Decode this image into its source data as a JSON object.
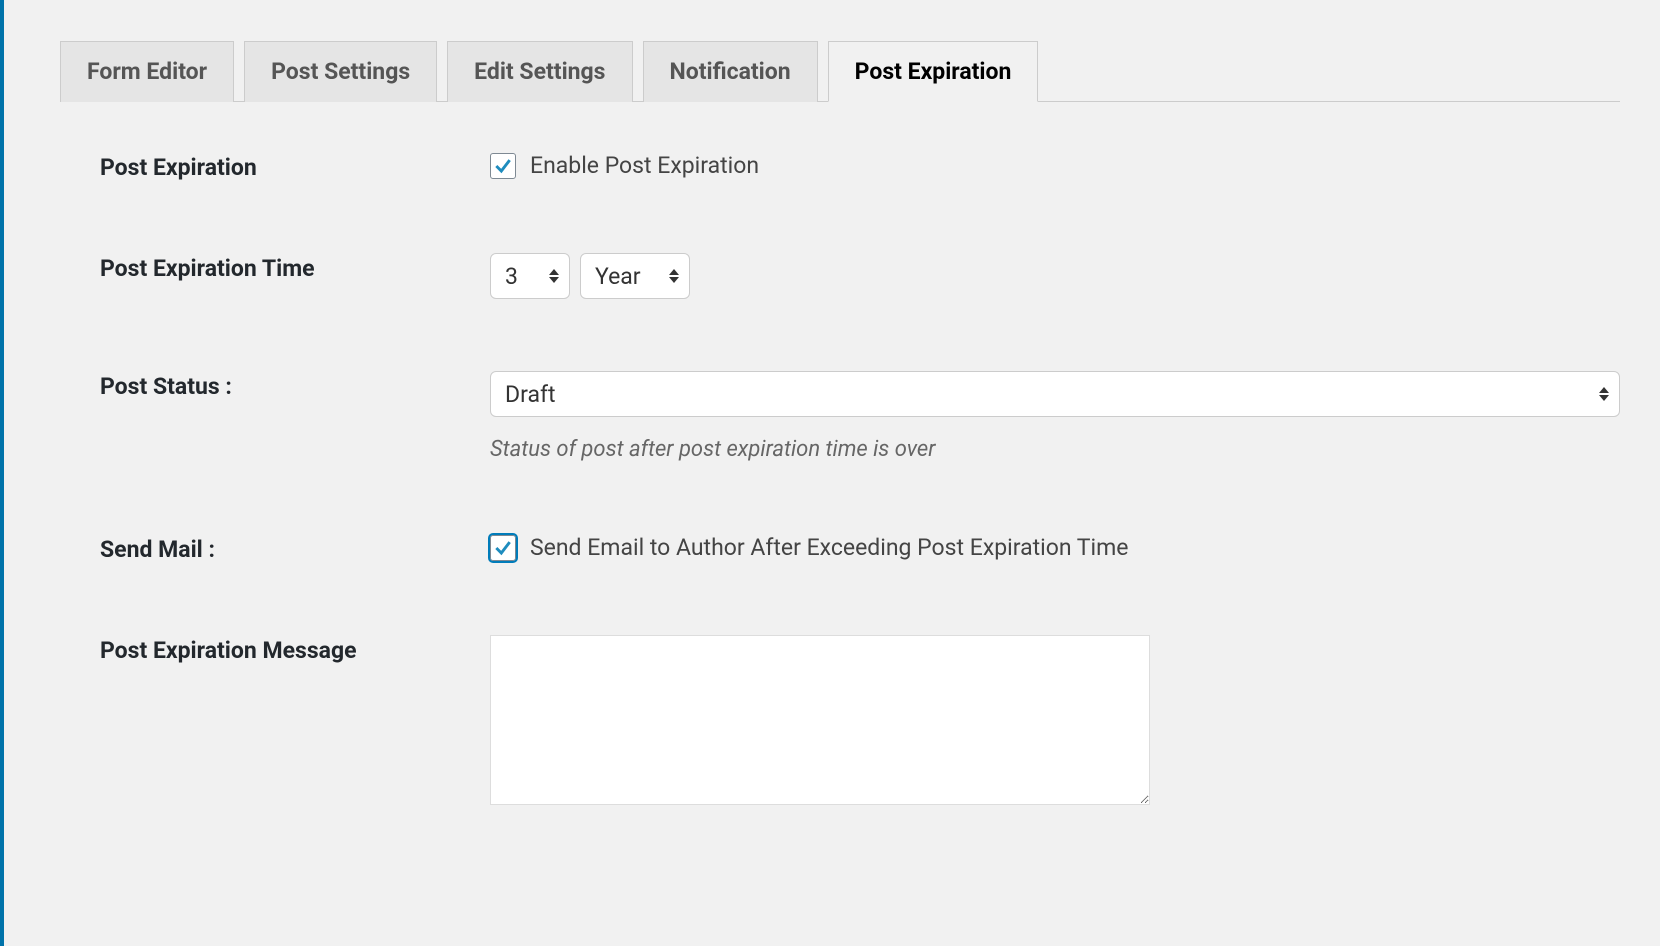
{
  "tabs": [
    {
      "label": "Form Editor",
      "active": false
    },
    {
      "label": "Post Settings",
      "active": false
    },
    {
      "label": "Edit Settings",
      "active": false
    },
    {
      "label": "Notification",
      "active": false
    },
    {
      "label": "Post Expiration",
      "active": true
    }
  ],
  "form": {
    "post_expiration": {
      "label": "Post Expiration",
      "checkbox_label": "Enable Post Expiration",
      "checked": true
    },
    "expiration_time": {
      "label": "Post Expiration Time",
      "number_value": "3",
      "unit_value": "Year"
    },
    "post_status": {
      "label": "Post Status :",
      "value": "Draft",
      "description": "Status of post after post expiration time is over"
    },
    "send_mail": {
      "label": "Send Mail :",
      "checkbox_label": "Send Email to Author After Exceeding Post Expiration Time",
      "checked": true
    },
    "expiration_message": {
      "label": "Post Expiration Message",
      "value": ""
    }
  }
}
